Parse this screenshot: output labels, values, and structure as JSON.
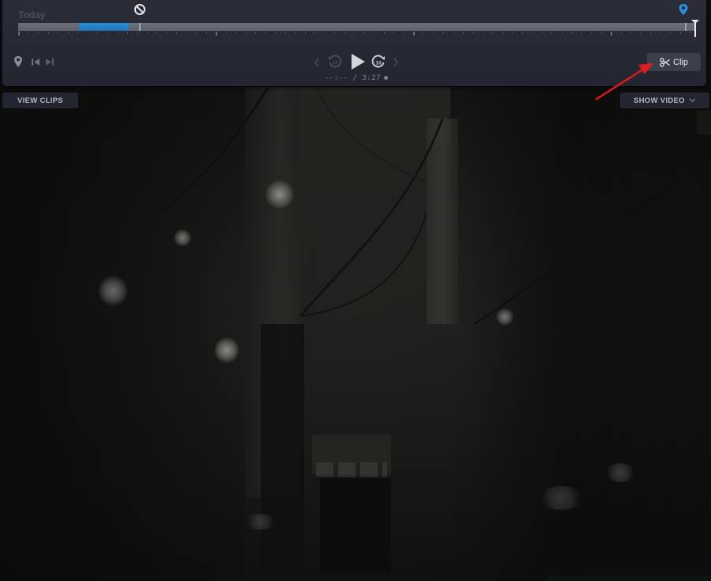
{
  "timeline": {
    "day_label": "Today",
    "recording_segment_color": "#1f7fc4",
    "marker_color": "#2b8fe0"
  },
  "playback": {
    "current_time": "--:--",
    "separator": " / ",
    "duration": "3:27",
    "rewind_seconds": "10",
    "forward_seconds": "10"
  },
  "buttons": {
    "clip_label": "Clip",
    "view_clips_label": "VIEW CLIPS",
    "show_video_label": "SHOW VIDEO"
  },
  "annotation": {
    "arrow_color": "#e01b1b",
    "points_to": "Clip"
  },
  "icons": {
    "no_entry": "prohibited-icon",
    "timeline_marker": "location-pin-icon",
    "add_marker": "location-pin-icon",
    "prev_marker": "skip-previous-icon",
    "next_marker": "skip-next-icon",
    "rewind": "replay-10-icon",
    "play": "play-icon",
    "forward": "forward-10-icon",
    "clip": "scissors-icon",
    "show_video_toggle": "chevron-down-icon"
  }
}
